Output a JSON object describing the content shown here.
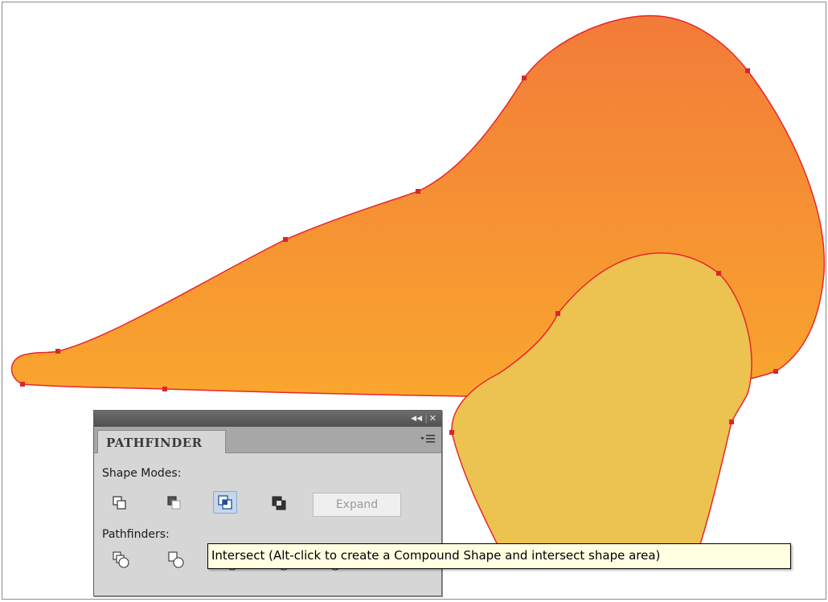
{
  "colors": {
    "outer_shape_top": "#f27b39",
    "outer_shape_bottom": "#f9a62e",
    "inner_shape_fill": "#ecc250",
    "path_stroke": "#e8262c",
    "anchor_point": "#d8262c",
    "panel_bg": "#d6d6d6",
    "tooltip_bg": "#ffffe1"
  },
  "panel": {
    "title": "PATHFINDER",
    "collapse_icon": "double-left-arrow-icon",
    "close_icon": "close-icon",
    "menu_icon": "panel-menu-icon",
    "shape_modes_label": "Shape Modes:",
    "shape_modes": [
      {
        "name": "unite-icon",
        "active": false
      },
      {
        "name": "minus-front-icon",
        "active": false
      },
      {
        "name": "intersect-icon",
        "active": true
      },
      {
        "name": "exclude-icon",
        "active": false
      }
    ],
    "expand_label": "Expand",
    "pathfinders_label": "Pathfinders:",
    "pathfinders": [
      {
        "name": "divide-icon"
      },
      {
        "name": "trim-icon"
      },
      {
        "name": "merge-icon"
      },
      {
        "name": "crop-icon"
      },
      {
        "name": "outline-icon"
      },
      {
        "name": "minus-back-icon"
      }
    ]
  },
  "tooltip": {
    "text": "Intersect (Alt-click to create a Compound Shape and intersect shape area)"
  }
}
